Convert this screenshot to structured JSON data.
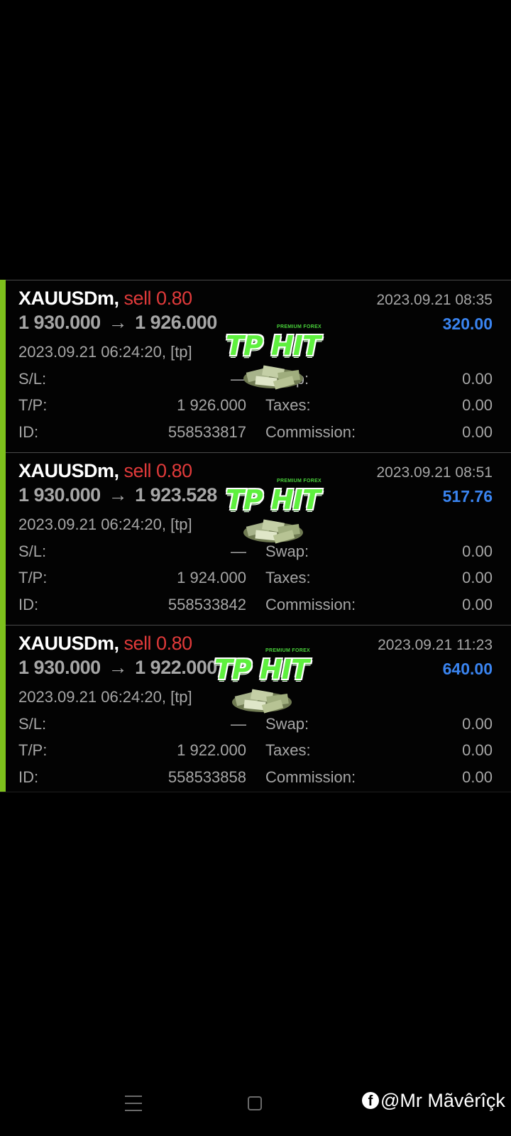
{
  "trades": [
    {
      "symbol": "XAUUSDm,",
      "side": "sell 0.80",
      "open_price": "1 930.000",
      "arrow": "→",
      "close_price": "1 926.000",
      "close_time": "2023.09.21 08:35",
      "profit": "320.00",
      "open_time": "2023.09.21 06:24:20, [tp]",
      "sl_label": "S/L:",
      "sl_value": "—",
      "tp_label": "T/P:",
      "tp_value": "1 926.000",
      "id_label": "ID:",
      "id_value": "558533817",
      "swap_label": "Swap:",
      "swap_value": "0.00",
      "taxes_label": "Taxes:",
      "taxes_value": "0.00",
      "commission_label": "Commission:",
      "commission_value": "0.00"
    },
    {
      "symbol": "XAUUSDm,",
      "side": "sell 0.80",
      "open_price": "1 930.000",
      "arrow": "→",
      "close_price": "1 923.528",
      "close_time": "2023.09.21 08:51",
      "profit": "517.76",
      "open_time": "2023.09.21 06:24:20, [tp]",
      "sl_label": "S/L:",
      "sl_value": "—",
      "tp_label": "T/P:",
      "tp_value": "1 924.000",
      "id_label": "ID:",
      "id_value": "558533842",
      "swap_label": "Swap:",
      "swap_value": "0.00",
      "taxes_label": "Taxes:",
      "taxes_value": "0.00",
      "commission_label": "Commission:",
      "commission_value": "0.00"
    },
    {
      "symbol": "XAUUSDm,",
      "side": "sell 0.80",
      "open_price": "1 930.000",
      "arrow": "→",
      "close_price": "1 922.000",
      "close_time": "2023.09.21 11:23",
      "profit": "640.00",
      "open_time": "2023.09.21 06:24:20, [tp]",
      "sl_label": "S/L:",
      "sl_value": "—",
      "tp_label": "T/P:",
      "tp_value": "1 922.000",
      "id_label": "ID:",
      "id_value": "558533858",
      "swap_label": "Swap:",
      "swap_value": "0.00",
      "taxes_label": "Taxes:",
      "taxes_value": "0.00",
      "commission_label": "Commission:",
      "commission_value": "0.00"
    }
  ],
  "sticker": {
    "premium": "PREMIUM FOREX",
    "text": "TP HIT",
    "icon": "money-pile-icon"
  },
  "colors": {
    "accent": "#7dc01c",
    "sell": "#e03a3a",
    "profit": "#3a84f0",
    "text_muted": "#a6a6a6",
    "sticker_green": "#5ef03e"
  },
  "nav": {
    "menu_icon": "hamburger-icon",
    "home_icon": "square-home-icon"
  },
  "watermark": {
    "icon": "facebook-icon",
    "text": "@Mr Mãvêrîçk"
  }
}
